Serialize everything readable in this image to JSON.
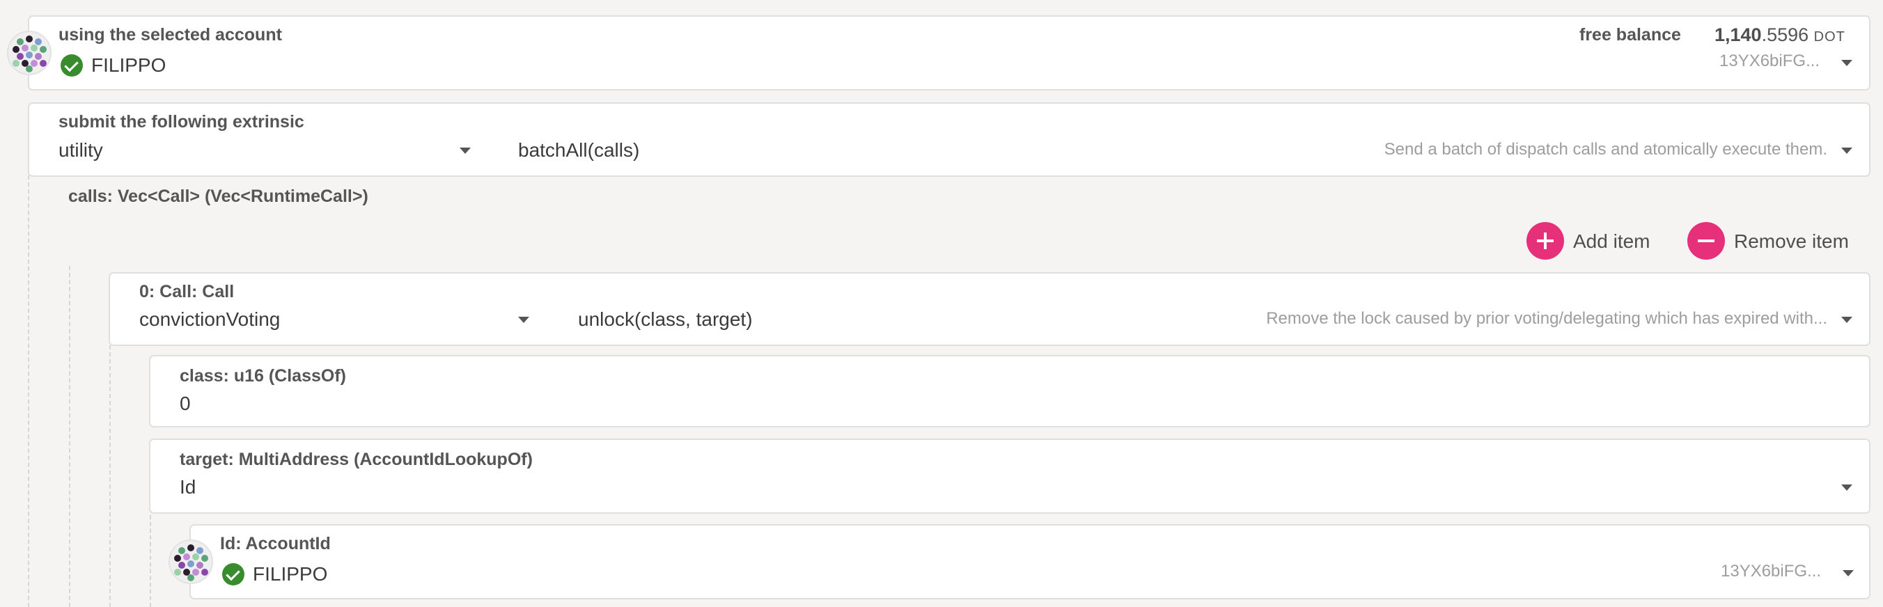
{
  "account": {
    "label": "using the selected account",
    "name": "FILIPPO",
    "address": "13YX6biFG...",
    "balance_label": "free balance",
    "balance_int": "1,140",
    "balance_dec": ".5596",
    "balance_unit": "DOT"
  },
  "extrinsic": {
    "label": "submit the following extrinsic",
    "module": "utility",
    "method": "batchAll(calls)",
    "description": "Send a batch of dispatch calls and atomically execute them."
  },
  "calls_param": {
    "label": "calls: Vec<Call> (Vec<RuntimeCall>)",
    "add_label": "Add item",
    "remove_label": "Remove item"
  },
  "call0": {
    "label": "0: Call: Call",
    "module": "convictionVoting",
    "method": "unlock(class, target)",
    "description": "Remove the lock caused by prior voting/delegating which has expired with..."
  },
  "class_param": {
    "label": "class: u16 (ClassOf)",
    "value": "0"
  },
  "target_param": {
    "label": "target: MultiAddress (AccountIdLookupOf)",
    "value": "Id"
  },
  "id_param": {
    "label": "Id: AccountId",
    "name": "FILIPPO",
    "address": "13YX6biFG..."
  },
  "colors": {
    "accent": "#e6317a",
    "check": "#398c2d",
    "background": "#f5f4f3"
  }
}
